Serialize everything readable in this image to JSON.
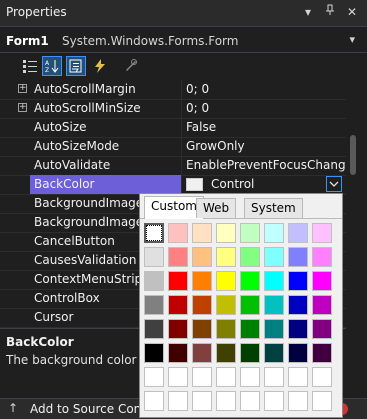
{
  "window": {
    "title": "Properties"
  },
  "titlebar_icons": {
    "dropdown": "▾",
    "pin": "📌",
    "close": "✕"
  },
  "object": {
    "name": "Form1",
    "type": "System.Windows.Forms.Form",
    "dropdown": "▾"
  },
  "properties": [
    {
      "name": "AutoScrollMargin",
      "value": "0; 0",
      "expandable": true
    },
    {
      "name": "AutoScrollMinSize",
      "value": "0; 0",
      "expandable": true
    },
    {
      "name": "AutoSize",
      "value": "False",
      "expandable": false
    },
    {
      "name": "AutoSizeMode",
      "value": "GrowOnly",
      "expandable": false
    },
    {
      "name": "AutoValidate",
      "value": "EnablePreventFocusChange",
      "expandable": false
    },
    {
      "name": "BackColor",
      "value": "Control",
      "expandable": false,
      "selected": true
    },
    {
      "name": "BackgroundImage",
      "value": "",
      "expandable": false
    },
    {
      "name": "BackgroundImageLayout",
      "value": "",
      "expandable": false
    },
    {
      "name": "CancelButton",
      "value": "",
      "expandable": false
    },
    {
      "name": "CausesValidation",
      "value": "",
      "expandable": false
    },
    {
      "name": "ContextMenuStrip",
      "value": "",
      "expandable": false
    },
    {
      "name": "ControlBox",
      "value": "",
      "expandable": false
    },
    {
      "name": "Cursor",
      "value": "",
      "expandable": false
    }
  ],
  "description": {
    "title": "BackColor",
    "text": "The background color"
  },
  "status": {
    "text": "Add to Source Control"
  },
  "color_picker": {
    "tabs": [
      "Custom",
      "Web",
      "System"
    ],
    "active_tab": "Custom",
    "palette": [
      [
        "#ffffff",
        "#ffc0c0",
        "#ffe0c0",
        "#ffffc0",
        "#c0ffc0",
        "#c0ffff",
        "#c0c0ff",
        "#ffc0ff"
      ],
      [
        "#e0e0e0",
        "#ff8080",
        "#ffc080",
        "#ffff80",
        "#80ff80",
        "#80ffff",
        "#8080ff",
        "#ff80ff"
      ],
      [
        "#c0c0c0",
        "#ff0000",
        "#ff8000",
        "#ffff00",
        "#00ff00",
        "#00ffff",
        "#0000ff",
        "#ff00ff"
      ],
      [
        "#808080",
        "#c00000",
        "#c04000",
        "#c0c000",
        "#00c000",
        "#00c0c0",
        "#0000c0",
        "#c000c0"
      ],
      [
        "#404040",
        "#800000",
        "#804000",
        "#808000",
        "#008000",
        "#008080",
        "#000080",
        "#800080"
      ],
      [
        "#000000",
        "#400000",
        "#804040",
        "#404000",
        "#004000",
        "#004040",
        "#000040",
        "#400040"
      ],
      [
        "#ffffff",
        "#ffffff",
        "#ffffff",
        "#ffffff",
        "#ffffff",
        "#ffffff",
        "#ffffff",
        "#ffffff"
      ],
      [
        "#ffffff",
        "#ffffff",
        "#ffffff",
        "#ffffff",
        "#ffffff",
        "#ffffff",
        "#ffffff",
        "#ffffff"
      ]
    ]
  },
  "colors": {
    "accent": "#6c5fd8",
    "focus": "#3794ff"
  }
}
